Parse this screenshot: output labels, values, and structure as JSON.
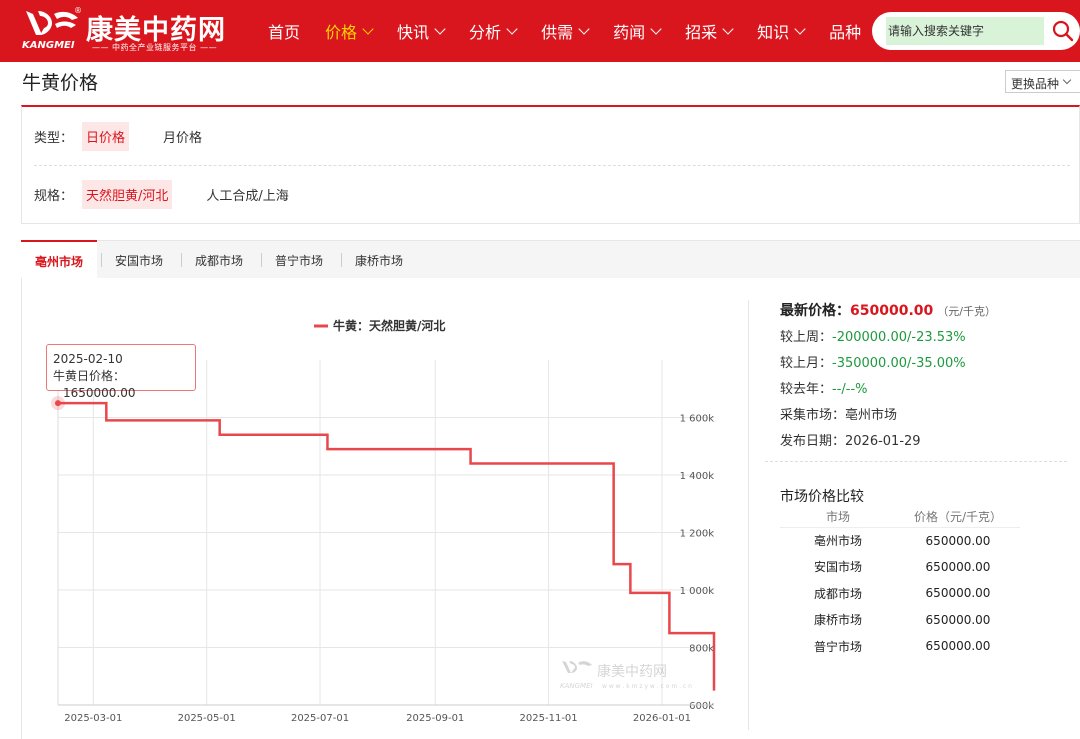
{
  "header": {
    "logo_cn": "康美中药网",
    "logo_en": "KANGMEI",
    "logo_sub": "—— 中药全产业链服务平台 ——",
    "logo_reg": "®",
    "brand_color": "#d9161e",
    "nav": [
      {
        "label": "首页",
        "dropdown": false,
        "active": false
      },
      {
        "label": "价格",
        "dropdown": true,
        "active": true
      },
      {
        "label": "快讯",
        "dropdown": true,
        "active": false
      },
      {
        "label": "分析",
        "dropdown": true,
        "active": false
      },
      {
        "label": "供需",
        "dropdown": true,
        "active": false
      },
      {
        "label": "药闻",
        "dropdown": true,
        "active": false
      },
      {
        "label": "招采",
        "dropdown": true,
        "active": false
      },
      {
        "label": "知识",
        "dropdown": true,
        "active": false
      },
      {
        "label": "品种",
        "dropdown": false,
        "active": false
      }
    ],
    "search_placeholder": "请输入搜索关键字",
    "search_icon": "search-icon"
  },
  "page": {
    "title": "牛黄价格",
    "switch_label": "更换品种"
  },
  "filters": {
    "type_label": "类型：",
    "type_options": [
      "日价格",
      "月价格"
    ],
    "type_active": 0,
    "spec_label": "规格：",
    "spec_options": [
      "天然胆黄/河北",
      "人工合成/上海"
    ],
    "spec_active": 0
  },
  "markets": {
    "tabs": [
      "亳州市场",
      "安国市场",
      "成都市场",
      "普宁市场",
      "康桥市场"
    ],
    "active": 0
  },
  "tooltip": {
    "date": "2025-02-10",
    "label": "牛黄日价格：",
    "value": "1650000.00"
  },
  "chart_data": {
    "type": "line",
    "series": [
      {
        "name": "牛黄：天然胆黄/河北",
        "color": "#e8474c",
        "interpolation": "step",
        "x": [
          "2025-02-10",
          "2025-03-08",
          "2025-04-10",
          "2025-05-08",
          "2025-06-01",
          "2025-07-05",
          "2025-08-10",
          "2025-09-20",
          "2025-10-15",
          "2025-11-10",
          "2025-12-01",
          "2025-12-06",
          "2025-12-10",
          "2025-12-15",
          "2025-12-20",
          "2026-01-01",
          "2026-01-05",
          "2026-01-25",
          "2026-01-29"
        ],
        "y": [
          1650000,
          1590000,
          1590000,
          1540000,
          1540000,
          1490000,
          1490000,
          1440000,
          1440000,
          1440000,
          1440000,
          1090000,
          1090000,
          990000,
          990000,
          990000,
          850000,
          850000,
          650000
        ]
      }
    ],
    "xticks": [
      "2025-03-01",
      "2025-05-01",
      "2025-07-01",
      "2025-09-01",
      "2025-11-01",
      "2026-01-01"
    ],
    "yticks": [
      "600k",
      "800k",
      "1 000k",
      "1 200k",
      "1 400k",
      "1 600k"
    ],
    "ylim": [
      600000,
      1800000
    ],
    "xlim": [
      "2025-02-10",
      "2026-01-29"
    ],
    "grid": true,
    "legend_position": "top-center"
  },
  "watermark": {
    "cn": "康美中药网",
    "en": "KANGMEI",
    "url": "w w w . k m z y w . c o m . c n"
  },
  "info": {
    "latest_label": "最新价格：",
    "latest_value": "650000.00",
    "latest_unit": "（元/千克）",
    "week_label": "较上周：",
    "week_value": "-200000.00/-23.53%",
    "month_label": "较上月：",
    "month_value": "-350000.00/-35.00%",
    "year_label": "较去年：",
    "year_value": "--/--%",
    "market_label": "采集市场：",
    "market_value": "亳州市场",
    "date_label": "发布日期：",
    "date_value": "2026-01-29",
    "up_color": "#1d9a3e"
  },
  "compare": {
    "title": "市场价格比较",
    "headers": [
      "市场",
      "价格（元/千克）"
    ],
    "rows": [
      [
        "亳州市场",
        "650000.00"
      ],
      [
        "安国市场",
        "650000.00"
      ],
      [
        "成都市场",
        "650000.00"
      ],
      [
        "康桥市场",
        "650000.00"
      ],
      [
        "普宁市场",
        "650000.00"
      ]
    ]
  }
}
